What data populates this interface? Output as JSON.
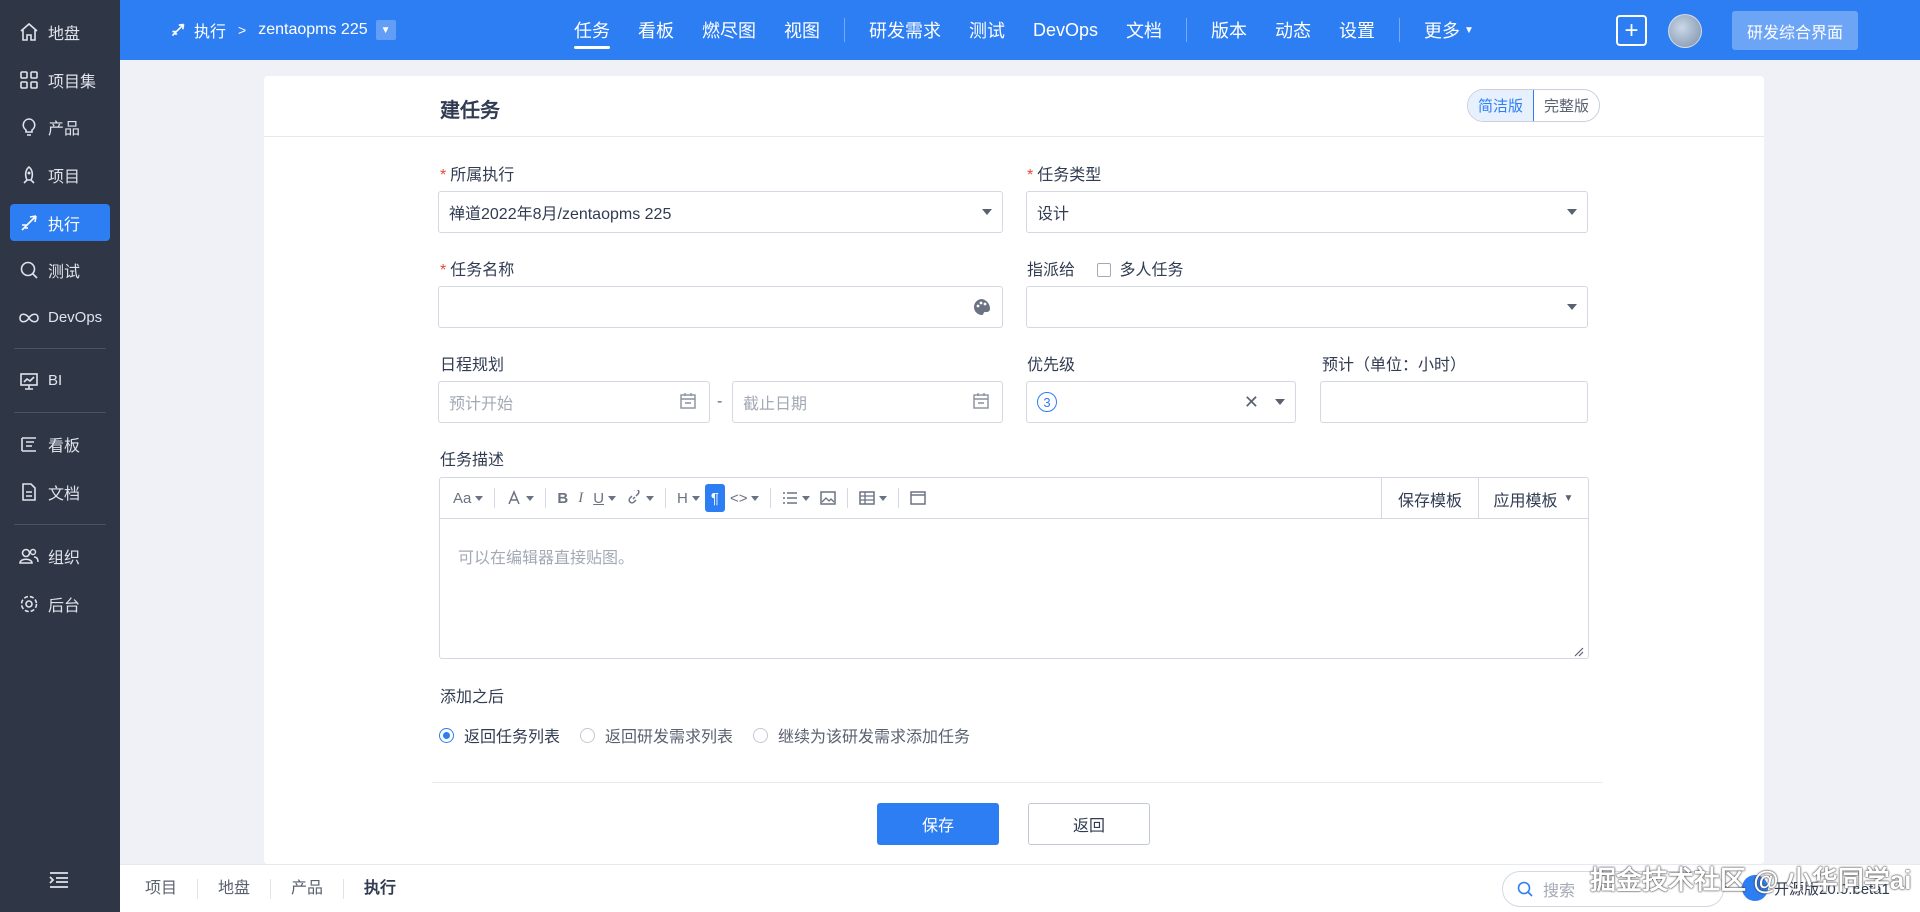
{
  "sidebar": {
    "items": [
      {
        "label": "地盘",
        "icon": "home-icon"
      },
      {
        "label": "项目集",
        "icon": "grid-icon"
      },
      {
        "label": "产品",
        "icon": "bulb-icon"
      },
      {
        "label": "项目",
        "icon": "rocket-icon"
      },
      {
        "label": "执行",
        "icon": "send-icon",
        "active": true
      },
      {
        "label": "测试",
        "icon": "magnifier-icon"
      },
      {
        "label": "DevOps",
        "icon": "infinity-icon"
      },
      {
        "label": "BI",
        "icon": "chart-board-icon"
      },
      {
        "label": "看板",
        "icon": "kanban-icon"
      },
      {
        "label": "文档",
        "icon": "document-icon"
      },
      {
        "label": "组织",
        "icon": "people-icon"
      },
      {
        "label": "后台",
        "icon": "gear-icon"
      }
    ]
  },
  "header": {
    "crumb_root": "执行",
    "crumb_execution": "zentaopms 225",
    "nav": [
      "任务",
      "看板",
      "燃尽图",
      "视图",
      "研发需求",
      "测试",
      "DevOps",
      "文档",
      "版本",
      "动态",
      "设置",
      "更多"
    ],
    "active_nav": "任务",
    "action_button": "研发综合界面",
    "accent": "#2e7ef3"
  },
  "form": {
    "title": "建任务",
    "mode_simple": "简洁版",
    "mode_full": "完整版",
    "execution_label": "所属执行",
    "execution_value": "禅道2022年8月/zentaopms 225",
    "type_label": "任务类型",
    "type_value": "设计",
    "name_label": "任务名称",
    "assign_label": "指派给",
    "multi_label": "多人任务",
    "schedule_label": "日程规划",
    "start_placeholder": "预计开始",
    "dash": "-",
    "end_placeholder": "截止日期",
    "priority_label": "优先级",
    "priority_value": "3",
    "estimate_label": "预计（单位：小时）",
    "desc_label": "任务描述",
    "save_template": "保存模板",
    "apply_template": "应用模板",
    "editor_placeholder": "可以在编辑器直接贴图。",
    "after_label": "添加之后",
    "after_options": [
      "返回任务列表",
      "返回研发需求列表",
      "继续为该研发需求添加任务"
    ],
    "save": "保存",
    "back": "返回"
  },
  "bottombar": {
    "crumbs": [
      "项目",
      "地盘",
      "产品",
      "执行"
    ],
    "search_placeholder": "搜索",
    "version": "开源版20.0.beta1"
  },
  "watermark": "掘金技术社区 @ 小华同学ai"
}
